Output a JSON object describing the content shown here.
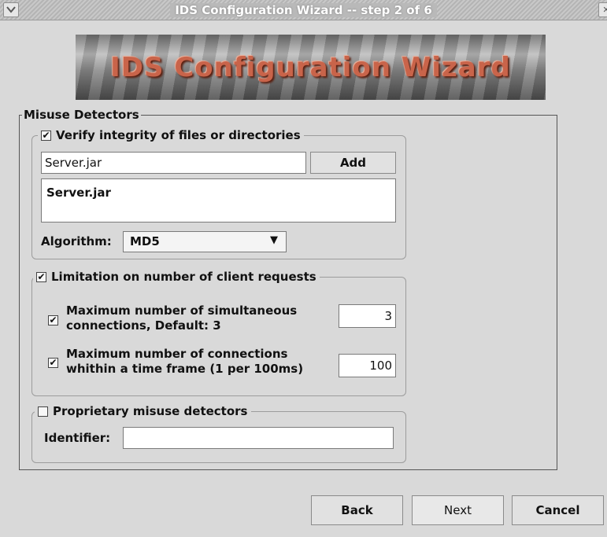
{
  "window": {
    "title": "IDS Configuration Wizard -- step 2 of 6"
  },
  "banner": {
    "text": "IDS Configuration Wizard"
  },
  "misuse_detectors": {
    "legend": "Misuse Detectors",
    "integrity": {
      "checked": true,
      "label": "Verify integrity of files or directories",
      "path_value": "Server.jar",
      "add_label": "Add",
      "files_list": [
        "Server.jar"
      ],
      "algorithm_label": "Algorithm:",
      "algorithm_value": "MD5"
    },
    "limitation": {
      "checked": true,
      "label": "Limitation on number of client requests",
      "simultaneous": {
        "checked": true,
        "label_line1": "Maximum number of simultaneous",
        "label_line2": "connections, Default: 3",
        "value": "3"
      },
      "timeframe": {
        "checked": true,
        "label_line1": "Maximum number of connections",
        "label_line2": "whithin a time frame (1 per 100ms)",
        "value": "100"
      }
    },
    "proprietary": {
      "checked": false,
      "label": "Proprietary misuse detectors",
      "identifier_label": "Identifier:",
      "identifier_value": ""
    }
  },
  "footer": {
    "back_label": "Back",
    "next_label": "Next",
    "cancel_label": "Cancel"
  },
  "icons": {
    "checkmark": "✔",
    "dropdown": "▼",
    "close": "✕",
    "minimize": "⌄"
  }
}
